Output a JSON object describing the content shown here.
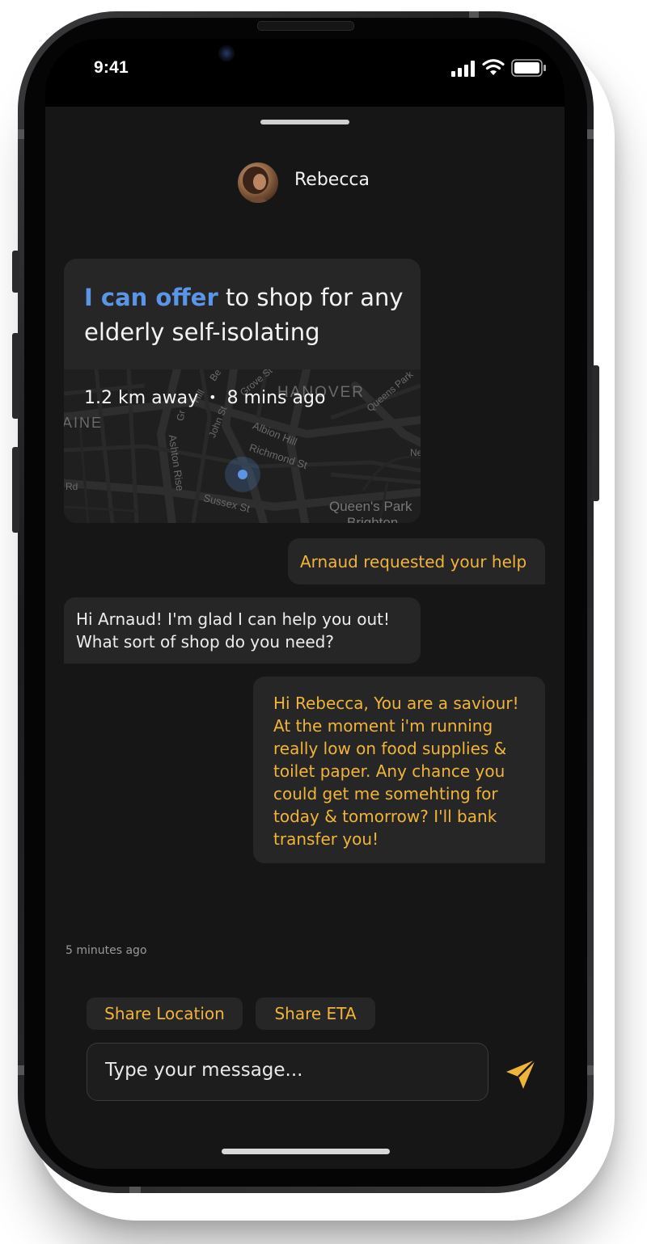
{
  "status_bar": {
    "time": "9:41",
    "icons": [
      "signal-icon",
      "wifi-icon",
      "battery-icon"
    ]
  },
  "header": {
    "contact_name": "Rebecca",
    "avatar_icon": "avatar"
  },
  "offer_card": {
    "highlight": "I can offer",
    "text": " to shop for any elderly self-isolating",
    "distance": "1.2 km away",
    "separator": "•",
    "posted": "8 mins ago",
    "map_labels": [
      "HANOVER",
      "AINE",
      "Albion Hill",
      "Richmond St",
      "Sussex St",
      "Ashton Rise",
      "John St",
      "Grove St",
      "Queens Park",
      "Queen's Park",
      "Brighton",
      "Gr",
      "Hill",
      "Be",
      "Rd",
      "Ne"
    ]
  },
  "messages": [
    {
      "from": "me",
      "text": "Arnaud requested your help"
    },
    {
      "from": "them",
      "text": "Hi Arnaud! I'm glad I can help you out!\nWhat sort of shop do you need?"
    },
    {
      "from": "me",
      "text": "Hi Rebecca, You are a saviour!\nAt the moment i'm running\nreally low on food supplies &\ntoilet paper. Any chance you\ncould get me somehting for\ntoday & tomorrow? I'll bank\ntransfer you!"
    }
  ],
  "timestamp": "5 minutes ago",
  "quick_replies": [
    "Share Location",
    "Share ETA"
  ],
  "composer": {
    "placeholder": "Type your message...",
    "send_icon": "send-icon"
  },
  "colors": {
    "accent_out": "#f1b43a",
    "accent_offer": "#5b95e8",
    "bubble_bg": "#262626",
    "screen_bg": "#161616"
  }
}
